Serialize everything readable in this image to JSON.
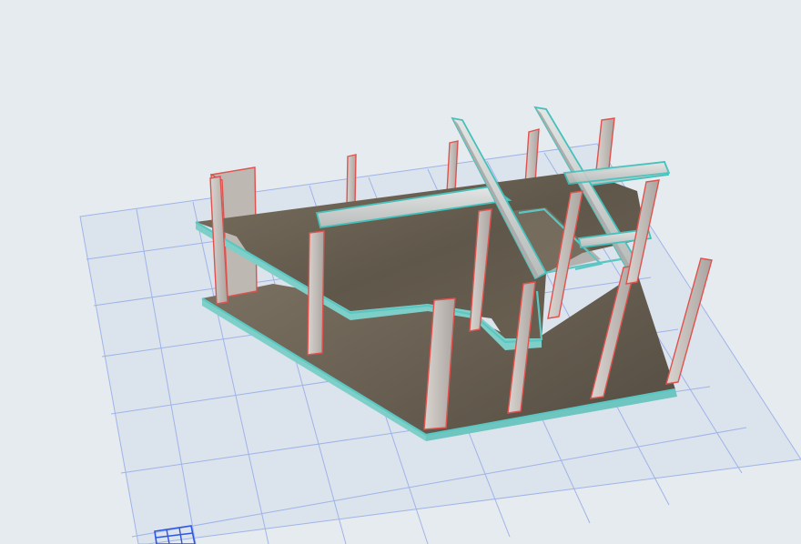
{
  "colors": {
    "background": "#e6ebef",
    "ground_plane": "#dbe3ed",
    "grid_line": "#9fb4e8",
    "slab_wood": "#6d6354",
    "slab_edge_highlight": "#5cc7c2",
    "column_fill": "#c9c4bf",
    "column_outline": "#e0524d",
    "beam_fill": "#cfd2d0",
    "beam_outline": "#44c1bb",
    "nav_grid_icon": "#2f57e0"
  },
  "icons": {
    "navigation": "grid-navigation-icon"
  }
}
